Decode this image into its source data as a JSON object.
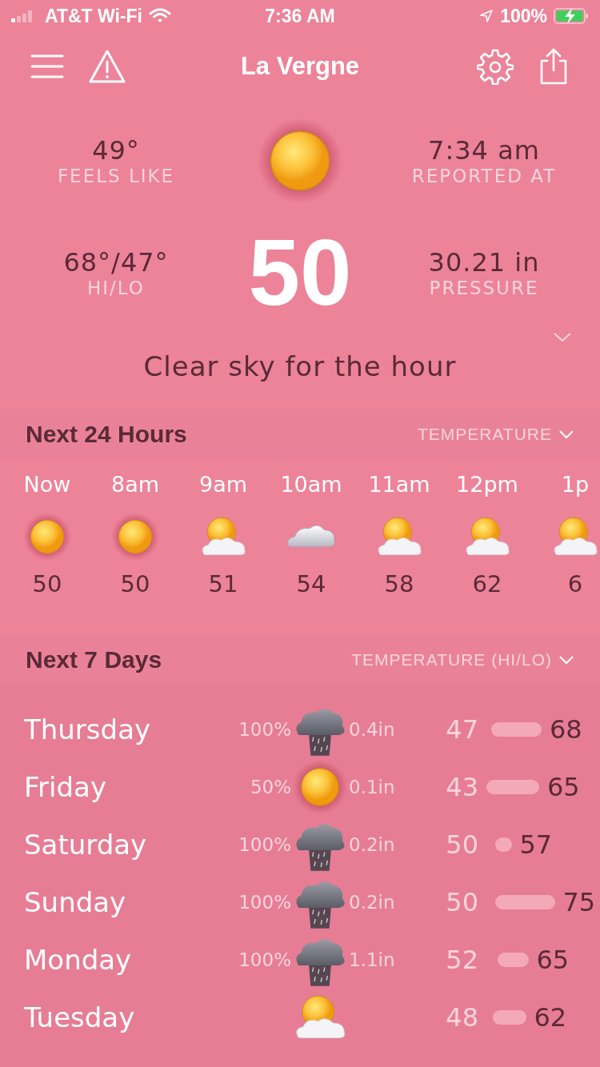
{
  "status_bar": {
    "carrier": "AT&T Wi-Fi",
    "time": "7:36 AM",
    "battery": "100%"
  },
  "nav": {
    "title": "La Vergne"
  },
  "current": {
    "feels_like": {
      "value": "49°",
      "label": "FEELS LIKE"
    },
    "reported_at": {
      "value": "7:34 am",
      "label": "REPORTED AT"
    },
    "hi_lo": {
      "value": "68°/47°",
      "label": "HI/LO"
    },
    "temperature": "50",
    "pressure": {
      "value": "30.21 in",
      "label": "PRESSURE"
    },
    "kind": "sun",
    "summary": "Clear sky for the hour"
  },
  "hourly": {
    "title": "Next 24 Hours",
    "metric": "TEMPERATURE",
    "items": [
      {
        "time": "Now",
        "kind": "sun",
        "temp": "50"
      },
      {
        "time": "8am",
        "kind": "sun",
        "temp": "50"
      },
      {
        "time": "9am",
        "kind": "partly",
        "temp": "51"
      },
      {
        "time": "10am",
        "kind": "cloudy",
        "temp": "54"
      },
      {
        "time": "11am",
        "kind": "partly",
        "temp": "58"
      },
      {
        "time": "12pm",
        "kind": "partly",
        "temp": "62"
      },
      {
        "time": "1p",
        "kind": "partly",
        "temp": "6"
      }
    ]
  },
  "daily": {
    "title": "Next 7 Days",
    "metric": "TEMPERATURE (HI/LO)",
    "days": [
      {
        "day": "Thursday",
        "precip_chance": "100%",
        "kind": "rain",
        "precip_amount": "0.4in",
        "low": "47",
        "high": "68"
      },
      {
        "day": "Friday",
        "precip_chance": "50%",
        "kind": "sun",
        "precip_amount": "0.1in",
        "low": "43",
        "high": "65"
      },
      {
        "day": "Saturday",
        "precip_chance": "100%",
        "kind": "rain",
        "precip_amount": "0.2in",
        "low": "50",
        "high": "57"
      },
      {
        "day": "Sunday",
        "precip_chance": "100%",
        "kind": "rain",
        "precip_amount": "0.2in",
        "low": "50",
        "high": "75"
      },
      {
        "day": "Monday",
        "precip_chance": "100%",
        "kind": "rain",
        "precip_amount": "1.1in",
        "low": "52",
        "high": "65"
      },
      {
        "day": "Tuesday",
        "kind": "partly",
        "low": "48",
        "high": "62"
      }
    ]
  }
}
